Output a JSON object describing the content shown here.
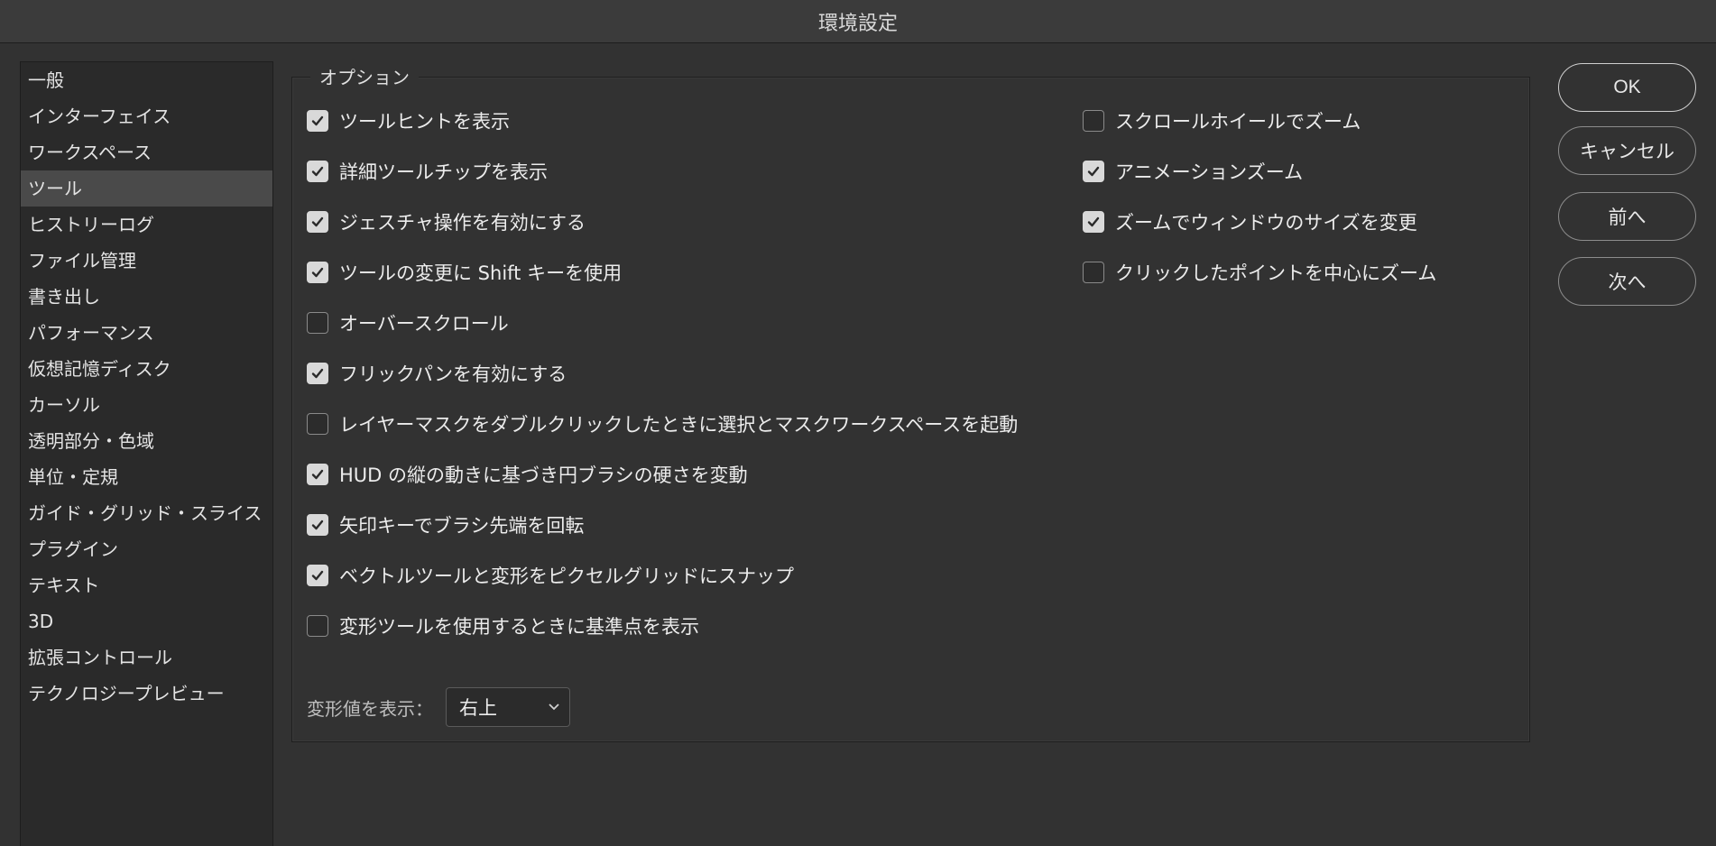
{
  "window": {
    "title": "環境設定"
  },
  "sidebar": {
    "items": [
      {
        "label": "一般",
        "selected": false
      },
      {
        "label": "インターフェイス",
        "selected": false
      },
      {
        "label": "ワークスペース",
        "selected": false
      },
      {
        "label": "ツール",
        "selected": true
      },
      {
        "label": "ヒストリーログ",
        "selected": false
      },
      {
        "label": "ファイル管理",
        "selected": false
      },
      {
        "label": "書き出し",
        "selected": false
      },
      {
        "label": "パフォーマンス",
        "selected": false
      },
      {
        "label": "仮想記憶ディスク",
        "selected": false
      },
      {
        "label": "カーソル",
        "selected": false
      },
      {
        "label": "透明部分・色域",
        "selected": false
      },
      {
        "label": "単位・定規",
        "selected": false
      },
      {
        "label": "ガイド・グリッド・スライス",
        "selected": false
      },
      {
        "label": "プラグイン",
        "selected": false
      },
      {
        "label": "テキスト",
        "selected": false
      },
      {
        "label": "3D",
        "selected": false
      },
      {
        "label": "拡張コントロール",
        "selected": false
      },
      {
        "label": "テクノロジープレビュー",
        "selected": false
      }
    ]
  },
  "options": {
    "legend": "オプション",
    "left_checkboxes": [
      {
        "label": "ツールヒントを表示",
        "checked": true
      },
      {
        "label": "詳細ツールチップを表示",
        "checked": true
      },
      {
        "label": "ジェスチャ操作を有効にする",
        "checked": true
      },
      {
        "label": "ツールの変更に Shift キーを使用",
        "checked": true
      },
      {
        "label": "オーバースクロール",
        "checked": false
      },
      {
        "label": "フリックパンを有効にする",
        "checked": true
      },
      {
        "label": "レイヤーマスクをダブルクリックしたときに選択とマスクワークスペースを起動",
        "checked": false
      },
      {
        "label": "HUD の縦の動きに基づき円ブラシの硬さを変動",
        "checked": true
      },
      {
        "label": "矢印キーでブラシ先端を回転",
        "checked": true
      },
      {
        "label": "ベクトルツールと変形をピクセルグリッドにスナップ",
        "checked": true
      },
      {
        "label": "変形ツールを使用するときに基準点を表示",
        "checked": false
      }
    ],
    "right_checkboxes": [
      {
        "label": "スクロールホイールでズーム",
        "checked": false
      },
      {
        "label": "アニメーションズーム",
        "checked": true
      },
      {
        "label": "ズームでウィンドウのサイズを変更",
        "checked": true
      },
      {
        "label": "クリックしたポイントを中心にズーム",
        "checked": false
      }
    ],
    "transform_values": {
      "label": "変形値を表示：",
      "selected": "右上"
    }
  },
  "buttons": {
    "ok": "OK",
    "cancel": "キャンセル",
    "prev": "前へ",
    "next": "次へ"
  },
  "colors": {
    "background": "#323232",
    "sidebar_bg": "#2a2a2a",
    "selected_item": "#4a4a4a",
    "checkbox_on": "#d9d9d9"
  }
}
